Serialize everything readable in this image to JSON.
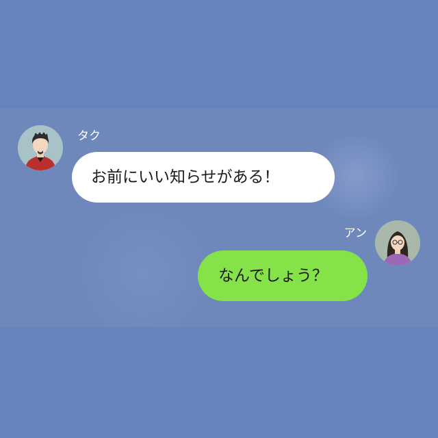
{
  "messages": [
    {
      "sender": "タク",
      "avatar_icon": "man-avatar-icon",
      "text": "お前にいい知らせがある！",
      "bubble_color": "#ffffff",
      "side": "left"
    },
    {
      "sender": "アン",
      "avatar_icon": "woman-avatar-icon",
      "text": "なんでしょう？",
      "bubble_color": "#85e249",
      "side": "right"
    }
  ],
  "colors": {
    "background": "#6f88bc",
    "letterbox": "#6584bd",
    "name_text": "#ffffff",
    "message_text": "#1a1a1a"
  }
}
